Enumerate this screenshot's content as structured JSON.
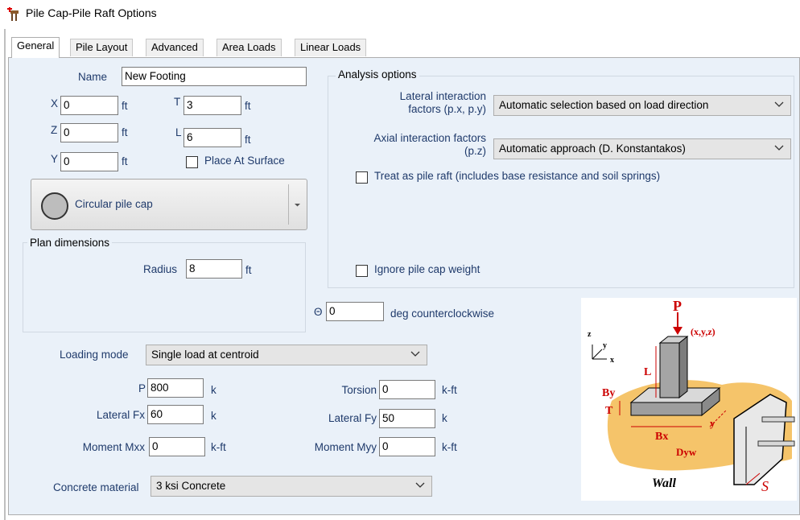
{
  "window": {
    "title": "Pile Cap-Pile Raft Options"
  },
  "tabs": [
    "General",
    "Pile Layout",
    "Advanced",
    "Area Loads",
    "Linear Loads"
  ],
  "general": {
    "name_label": "Name",
    "name_value": "New Footing",
    "x_label": "X",
    "x_value": "0",
    "x_unit": "ft",
    "t_label": "T",
    "t_value": "3",
    "t_unit": "ft",
    "z_label": "Z",
    "z_value": "0",
    "z_unit": "ft",
    "l_label": "L",
    "l_value": "6",
    "l_unit": "ft",
    "y_label": "Y",
    "y_value": "0",
    "y_unit": "ft",
    "place_at_surface_label": "Place At Surface",
    "pile_cap_type": "Circular pile cap",
    "plan_dimensions_title": "Plan dimensions",
    "radius_label": "Radius",
    "radius_value": "8",
    "radius_unit": "ft",
    "theta_label": "Θ",
    "theta_value": "0",
    "theta_unit": "deg counterclockwise"
  },
  "analysis": {
    "title": "Analysis options",
    "lateral_label_1": "Lateral interaction",
    "lateral_label_2": "factors (p.x, p.y)",
    "lateral_value": "Automatic selection based on load direction",
    "axial_label_1": "Axial interaction factors",
    "axial_label_2": "(p.z)",
    "axial_value": "Automatic approach (D. Konstantakos)",
    "pile_raft_label": "Treat as pile raft (includes base resistance and soil springs)",
    "ignore_weight_label": "Ignore pile cap weight"
  },
  "loading": {
    "mode_label": "Loading mode",
    "mode_value": "Single load at centroid",
    "p_label": "P",
    "p_value": "800",
    "p_unit": "k",
    "torsion_label": "Torsion",
    "torsion_value": "0",
    "torsion_unit": "k-ft",
    "fx_label": "Lateral Fx",
    "fx_value": "60",
    "fx_unit": "k",
    "fy_label": "Lateral Fy",
    "fy_value": "50",
    "fy_unit": "k",
    "mxx_label": "Moment Mxx",
    "mxx_value": "0",
    "mxx_unit": "k-ft",
    "myy_label": "Moment Myy",
    "myy_value": "0",
    "myy_unit": "k-ft",
    "concrete_label": "Concrete material",
    "concrete_value": "3 ksi Concrete"
  },
  "diagram": {
    "p": "P",
    "xyz": "(x,y,z)",
    "axis_z": "z",
    "axis_y": "y",
    "axis_x": "x",
    "L": "L",
    "By": "By",
    "T": "T",
    "Bx": "Bx",
    "y": "y",
    "Dyw": "Dyw",
    "wall": "Wall",
    "S": "S"
  },
  "colors": {
    "panel_bg": "#eaf1f9",
    "label_blue": "#1f3a6b",
    "diagram_red": "#cc0000",
    "soil": "#f5c46a"
  }
}
